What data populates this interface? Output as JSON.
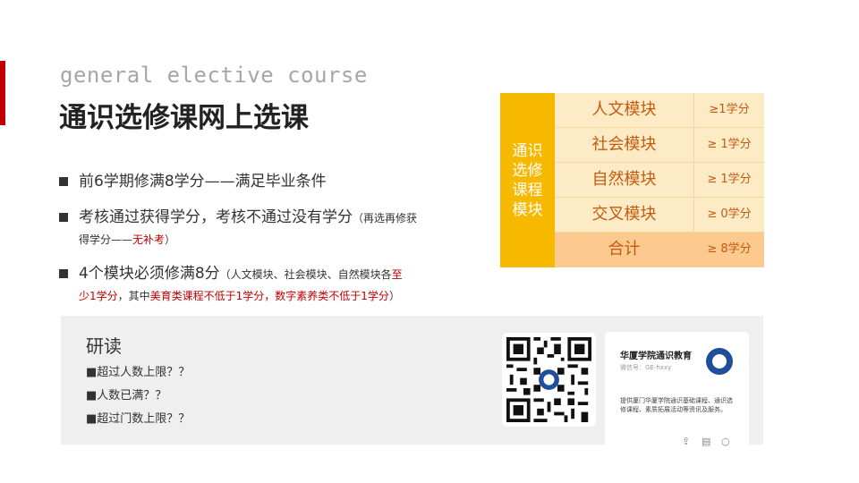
{
  "header": {
    "subtitle_en": "general elective course",
    "title": "通识选修课网上选课"
  },
  "bullets": [
    {
      "main": "前6学期修满8学分——满足毕业条件"
    },
    {
      "main": "考核通过获得学分，考核不通过没有学分",
      "note_a": "（再选再修获",
      "note_b": "得学分——",
      "note_red": "无补考",
      "note_c": "）"
    },
    {
      "main": "4个模块必须修满8分",
      "note_a": "（人文模块、社会模块、自然模块各",
      "note_red1": "至",
      "note_red1b": "少1学分",
      "note_b": "，其中",
      "note_red2": "美育类课程不低于1学分，数字素养类不低于1学分",
      "note_c": "）"
    }
  ],
  "module_table": {
    "side_label": "通识选修课程模块",
    "rows": [
      {
        "name": "人文模块",
        "credit": "≥1学分"
      },
      {
        "name": "社会模块",
        "credit": "≥ 1学分"
      },
      {
        "name": "自然模块",
        "credit": "≥ 1学分"
      },
      {
        "name": "交叉模块",
        "credit": "≥ 0学分"
      },
      {
        "name": "合计",
        "credit": "≥ 8学分"
      }
    ],
    "colors": {
      "side": "#f7b900",
      "row": "#fdebc5",
      "total": "#fcc98e",
      "text": "#c55a11"
    }
  },
  "panel": {
    "title": "研读",
    "questions": [
      "■超过人数上限？？",
      "■人数已满？？",
      "■超过门数上限？？"
    ]
  },
  "wechat_card": {
    "name": "华厦学院通识教育",
    "id": "微信号：GE-hxxy",
    "description": "提供厦门华厦学院通识基础课程、通识选修课程、素质拓展活动等资讯及服务。",
    "icons": [
      "share-icon",
      "document-icon",
      "comment-icon"
    ]
  },
  "accent_color": "#c00000"
}
